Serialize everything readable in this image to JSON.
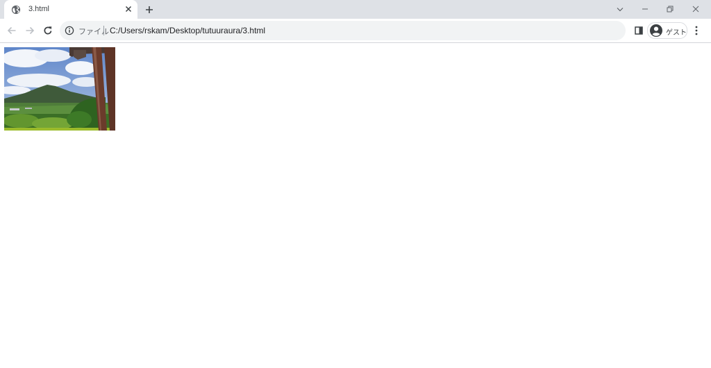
{
  "browser": {
    "tab": {
      "title": "3.html",
      "favicon": "globe-icon"
    },
    "address_bar": {
      "security_label": "ファイル",
      "url": "C:/Users/rskam/Desktop/tutuuraura/3.html"
    },
    "profile": {
      "label": "ゲスト"
    }
  },
  "page": {
    "image": {
      "subject": "mountain-landscape-photo"
    }
  },
  "colors": {
    "tabstrip": "#dee1e6",
    "omnibox": "#f1f3f4",
    "icon": "#5f6368"
  }
}
